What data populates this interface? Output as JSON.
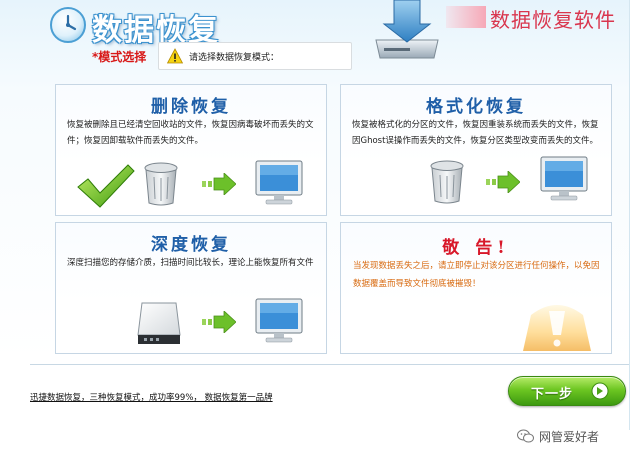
{
  "header": {
    "app_title": "数据恢复",
    "brand_text": "数据恢复软件",
    "mode_label": "*模式选择",
    "mode_prompt": "请选择数据恢复模式："
  },
  "options": [
    {
      "id": "delete",
      "title": "删除恢复",
      "description": "恢复被删除且已经清空回收站的文件，恢复因病毒破坏而丢失的文件；恢复因卸载软件而丢失的文件。",
      "icons": [
        "checkmark-icon",
        "recycle-bin-icon",
        "transfer-arrow-icon",
        "monitor-icon"
      ]
    },
    {
      "id": "format",
      "title": "格式化恢复",
      "description": "恢复被格式化的分区的文件，恢复因重装系统而丢失的文件，恢复因Ghost误操作而丢失的文件，恢复分区类型改变而丢失的文件。",
      "icons": [
        "recycle-bin-icon",
        "transfer-arrow-icon",
        "monitor-icon"
      ]
    },
    {
      "id": "deep",
      "title": "深度恢复",
      "description": "深度扫描您的存储介质，扫描时间比较长，理论上能恢复所有文件",
      "icons": [
        "hard-drive-icon",
        "transfer-arrow-icon",
        "monitor-icon"
      ]
    }
  ],
  "warning": {
    "title": "敬 告!",
    "text": "当发现数据丢失之后，请立即停止对该分区进行任何操作，以免因数据覆盖而导致文件彻底被摧毁！",
    "icon": "warning-light-icon"
  },
  "footer": {
    "slogan": "迅捷数据恢复，三种恢复模式，成功率99%， 数据恢复第一品牌",
    "next_label": "下一步",
    "watermark": "网管爱好者"
  },
  "colors": {
    "accent_blue": "#1f5fa8",
    "warning_red": "#d8182a",
    "warning_orange": "#d86a10",
    "button_green": "#6dc622",
    "brand_red": "#d9364e"
  }
}
